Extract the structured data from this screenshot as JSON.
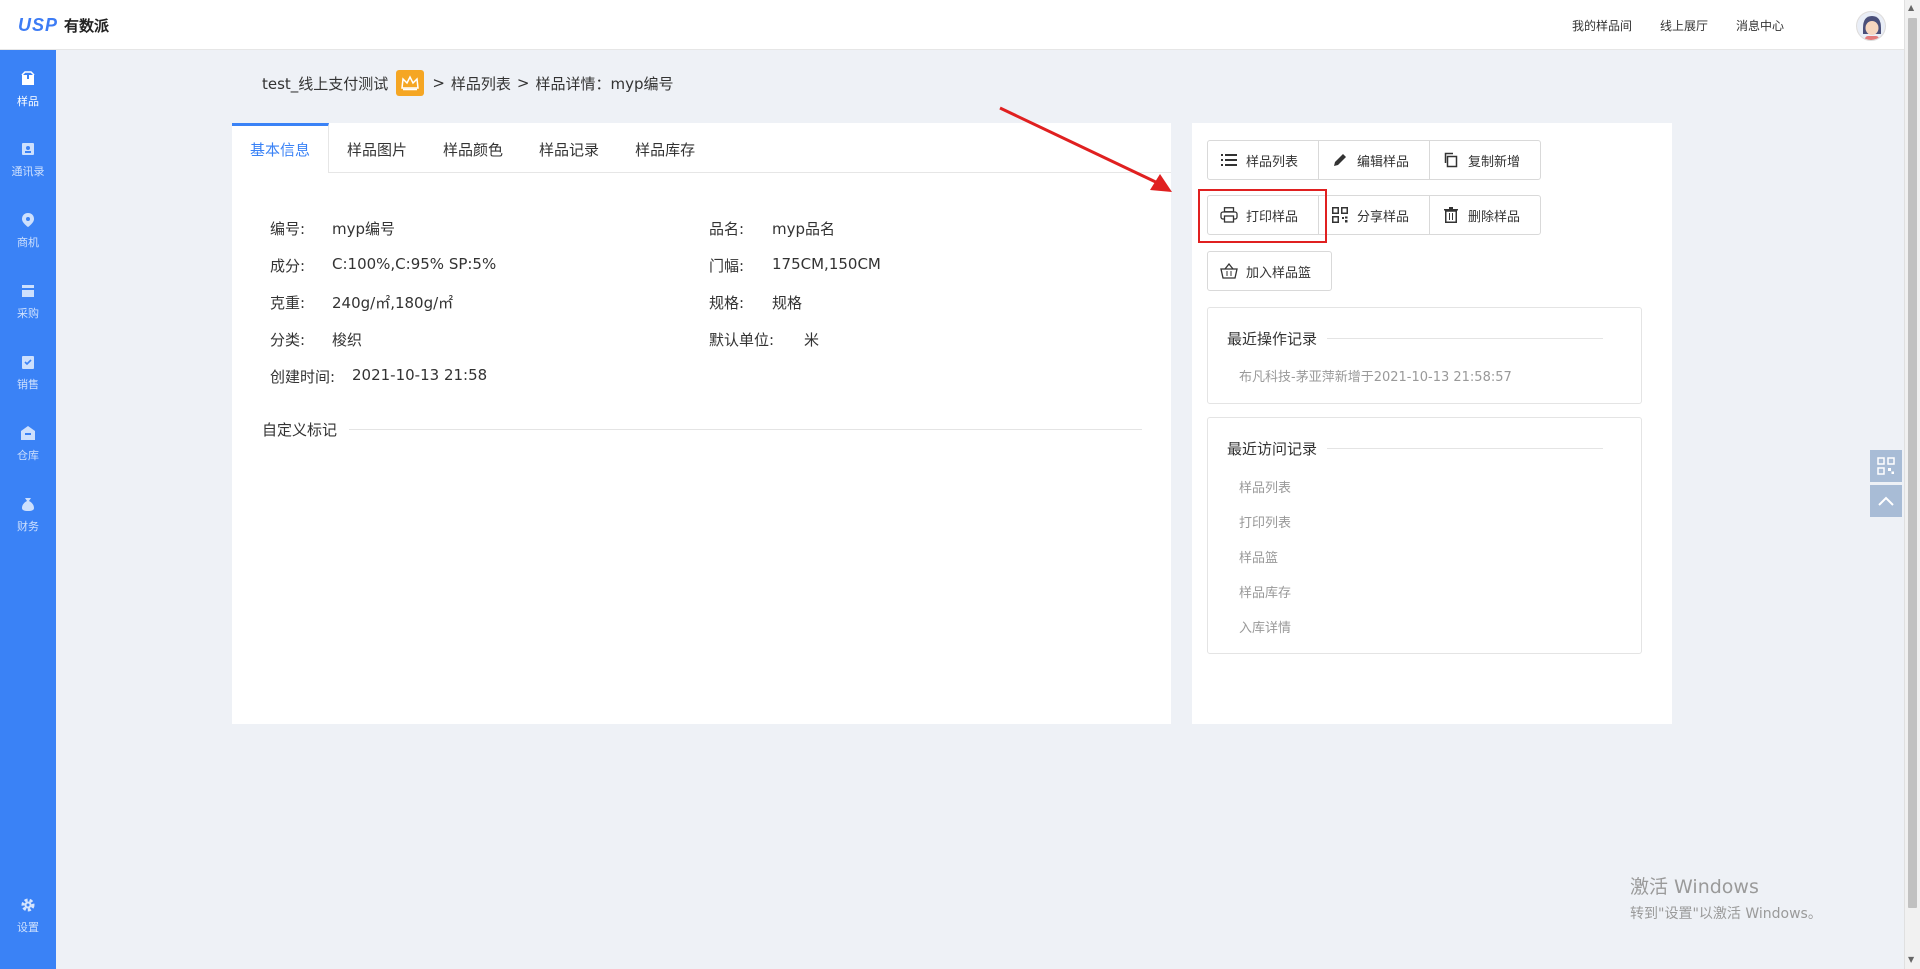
{
  "app": {
    "logo_mark": "USP",
    "logo_text": "有数派"
  },
  "topbar": {
    "links": [
      "我的样品间",
      "线上展厅",
      "消息中心"
    ]
  },
  "sidebar": {
    "items": [
      {
        "label": "样品",
        "icon": "box-icon",
        "active": true
      },
      {
        "label": "通讯录",
        "icon": "contacts-icon",
        "active": false
      },
      {
        "label": "商机",
        "icon": "location-pin-icon",
        "active": false
      },
      {
        "label": "采购",
        "icon": "cart-icon",
        "active": false
      },
      {
        "label": "销售",
        "icon": "clipboard-icon",
        "active": false
      },
      {
        "label": "仓库",
        "icon": "warehouse-icon",
        "active": false
      },
      {
        "label": "财务",
        "icon": "money-bag-icon",
        "active": false
      }
    ],
    "settings_label": "设置"
  },
  "breadcrumb": {
    "company": "test_线上支付测试",
    "sep1": ">",
    "list": "样品列表",
    "sep2": ">",
    "detail": "样品详情：myp编号"
  },
  "tabs": [
    "基本信息",
    "样品图片",
    "样品颜色",
    "样品记录",
    "样品库存"
  ],
  "info": {
    "code_label": "编号:",
    "code": "myp编号",
    "name_label": "品名:",
    "name": "myp品名",
    "composition_label": "成分:",
    "composition": "C:100%,C:95% SP:5%",
    "width_label": "门幅:",
    "width": "175CM,150CM",
    "weight_label": "克重:",
    "weight": "240g/㎡,180g/㎡",
    "spec_label": "规格:",
    "spec": "规格",
    "category_label": "分类:",
    "category": "梭织",
    "unit_label": "默认单位:",
    "unit": "米",
    "created_label": "创建时间:",
    "created": "2021-10-13 21:58"
  },
  "custom_mark_label": "自定义标记",
  "actions": {
    "row1": [
      "样品列表",
      "编辑样品",
      "复制新增"
    ],
    "row2": [
      "打印样品",
      "分享样品",
      "删除样品"
    ],
    "row3": [
      "加入样品篮"
    ]
  },
  "recent_ops": {
    "title": "最近操作记录",
    "items": [
      "布凡科技-茅亚萍新增于2021-10-13 21:58:57"
    ]
  },
  "recent_visits": {
    "title": "最近访问记录",
    "items": [
      "样品列表",
      "打印列表",
      "样品篮",
      "样品库存",
      "入库详情"
    ]
  },
  "watermark": {
    "line1": "激活 Windows",
    "line2": "转到\"设置\"以激活 Windows。"
  },
  "colors": {
    "accent": "#3a82f6",
    "highlight": "#e02020",
    "crown": "#f5a623"
  }
}
